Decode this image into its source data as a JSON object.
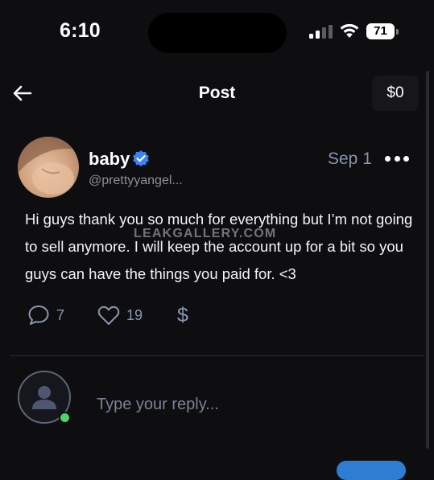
{
  "status_bar": {
    "time": "6:10",
    "battery": "71"
  },
  "header": {
    "title": "Post",
    "balance": "$0"
  },
  "post": {
    "author_name": "baby",
    "handle": "@prettyyangel...",
    "date": "Sep 1",
    "text": "Hi guys thank you so much for everything but I’m not going to sell anymore. I will keep the account up for a bit so you guys can have the things you paid for. <3",
    "watermark": "LEAKGALLERY.COM",
    "comments_count": "7",
    "likes_count": "19",
    "tip_symbol": "$"
  },
  "reply": {
    "placeholder": "Type your reply..."
  },
  "icons": {
    "back": "arrow-left-icon",
    "verified": "verified-badge-icon",
    "more": "more-horizontal-icon",
    "comment": "comment-icon",
    "like": "heart-icon",
    "tip": "dollar-icon",
    "user": "user-icon"
  },
  "colors": {
    "background": "#0e0e11",
    "muted_text": "#8a96b0",
    "verified": "#3b82f6",
    "online": "#4cd46b",
    "accent": "#2d7dd2"
  }
}
